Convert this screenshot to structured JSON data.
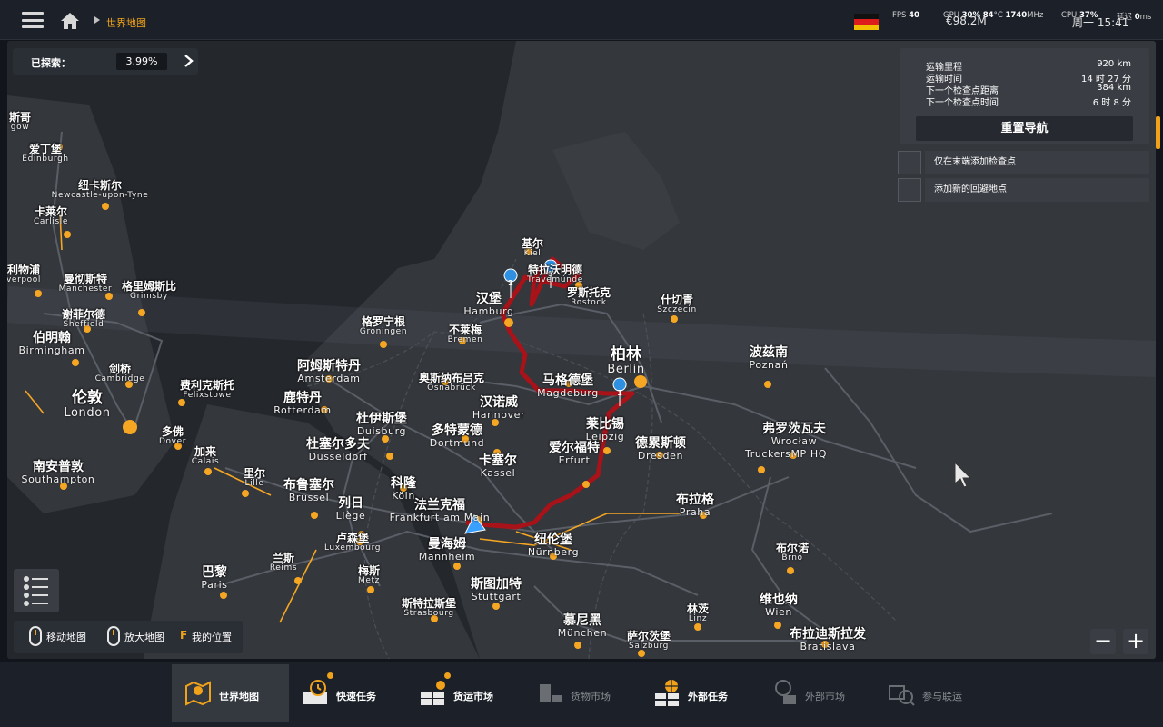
{
  "topbar": {
    "breadcrumb": "世界地图",
    "fps_label": "FPS",
    "fps_value": "40",
    "gpu_label": "GPU",
    "gpu_load": "30",
    "gpu_temp": "84",
    "gpu_temp_unit": "°C",
    "gpu_clock": "1740",
    "gpu_clock_unit": "MHz",
    "cpu_label": "CPU",
    "cpu_load": "37",
    "latency_label": "延迟",
    "latency_value": "0",
    "latency_unit": "ms",
    "money": "€98.2M",
    "clock": "周一 15:41"
  },
  "explore": {
    "label": "已探索：",
    "value": "3.99%"
  },
  "route_info": {
    "rows": [
      {
        "label": "运输里程",
        "value": "920 km"
      },
      {
        "label": "运输时间",
        "value": "14 时 27 分"
      },
      {
        "label": "下一个检查点距离",
        "value": "384 km"
      },
      {
        "label": "下一个检查点时间",
        "value": "6 时 8 分"
      }
    ],
    "reroute_label": "重置导航",
    "option1": "仅在末端添加检查点",
    "option2": "添加新的回避地点"
  },
  "controls": {
    "move_map": "移动地图",
    "zoom_map": "放大地图",
    "my_pos_key": "F",
    "my_pos": "我的位置"
  },
  "zoom": {
    "minus": "−",
    "plus": "+"
  },
  "waypoints": [
    "1",
    "2",
    "3"
  ],
  "cities": [
    {
      "zh": "斯哥",
      "en": "gow"
    },
    {
      "zh": "爱丁堡",
      "en": "Edinburgh"
    },
    {
      "zh": "纽卡斯尔",
      "en": "Newcastle-upon-Tyne"
    },
    {
      "zh": "卡莱尔",
      "en": "Carlisle"
    },
    {
      "zh": "利物浦",
      "en": "verpool"
    },
    {
      "zh": "曼彻斯特",
      "en": "Manchester"
    },
    {
      "zh": "格里姆斯比",
      "en": "Grimsby"
    },
    {
      "zh": "谢菲尔德",
      "en": "Sheffield"
    },
    {
      "zh": "伯明翰",
      "en": "Birmingham"
    },
    {
      "zh": "剑桥",
      "en": "Cambridge"
    },
    {
      "zh": "费利克斯托",
      "en": "Felixstowe"
    },
    {
      "zh": "伦敦",
      "en": "London"
    },
    {
      "zh": "多佛",
      "en": "Dover"
    },
    {
      "zh": "加来",
      "en": "Calais"
    },
    {
      "zh": "南安普敦",
      "en": "Southampton"
    },
    {
      "zh": "里尔",
      "en": "Lille"
    },
    {
      "zh": "布鲁塞尔",
      "en": "Brussel"
    },
    {
      "zh": "列日",
      "en": "Liège"
    },
    {
      "zh": "巴黎",
      "en": "Paris"
    },
    {
      "zh": "兰斯",
      "en": "Reims"
    },
    {
      "zh": "卢森堡",
      "en": "Luxembourg"
    },
    {
      "zh": "梅斯",
      "en": "Metz"
    },
    {
      "zh": "斯特拉斯堡",
      "en": "Strasbourg"
    },
    {
      "zh": "阿姆斯特丹",
      "en": "Amsterdam"
    },
    {
      "zh": "鹿特丹",
      "en": "Rotterdam"
    },
    {
      "zh": "格罗宁根",
      "en": "Groningen"
    },
    {
      "zh": "杜伊斯堡",
      "en": "Duisburg"
    },
    {
      "zh": "杜塞尔多夫",
      "en": "Düsseldorf"
    },
    {
      "zh": "科隆",
      "en": "Köln"
    },
    {
      "zh": "多特蒙德",
      "en": "Dortmund"
    },
    {
      "zh": "奥斯纳布吕克",
      "en": "Osnabrück"
    },
    {
      "zh": "不莱梅",
      "en": "Bremen"
    },
    {
      "zh": "汉堡",
      "en": "Hamburg"
    },
    {
      "zh": "基尔",
      "en": "Kiel"
    },
    {
      "zh": "特拉沃明德",
      "en": "Travemünde"
    },
    {
      "zh": "罗斯托克",
      "en": "Rostock"
    },
    {
      "zh": "什切青",
      "en": "Szczecin"
    },
    {
      "zh": "汉诺威",
      "en": "Hannover"
    },
    {
      "zh": "卡塞尔",
      "en": "Kassel"
    },
    {
      "zh": "法兰克福",
      "en": "Frankfurt am Main"
    },
    {
      "zh": "曼海姆",
      "en": "Mannheim"
    },
    {
      "zh": "斯图加特",
      "en": "Stuttgart"
    },
    {
      "zh": "纽伦堡",
      "en": "Nürnberg"
    },
    {
      "zh": "慕尼黑",
      "en": "München"
    },
    {
      "zh": "萨尔茨堡",
      "en": "Salzburg"
    },
    {
      "zh": "马格德堡",
      "en": "Magdeburg"
    },
    {
      "zh": "柏林",
      "en": "Berlin"
    },
    {
      "zh": "莱比锡",
      "en": "Leipzig"
    },
    {
      "zh": "爱尔福特",
      "en": "Erfurt"
    },
    {
      "zh": "德累斯顿",
      "en": "Dresden"
    },
    {
      "zh": "弗罗茨瓦夫",
      "en": "Wrocław"
    },
    {
      "zh": "",
      "en": "TruckersMP HQ"
    },
    {
      "zh": "波兹南",
      "en": "Poznań"
    },
    {
      "zh": "布拉格",
      "en": "Praha"
    },
    {
      "zh": "布尔诺",
      "en": "Brno"
    },
    {
      "zh": "林茨",
      "en": "Linz"
    },
    {
      "zh": "维也纳",
      "en": "Wien"
    },
    {
      "zh": "布拉迪斯拉发",
      "en": "Bratislava"
    }
  ],
  "tabs": [
    {
      "label": "世界地图"
    },
    {
      "label": "快速任务"
    },
    {
      "label": "货运市场"
    },
    {
      "label": "货物市场"
    },
    {
      "label": "外部任务"
    },
    {
      "label": "外部市场"
    },
    {
      "label": "参与联运"
    }
  ],
  "colors": {
    "accent": "#f0a21a",
    "route": "#b5141a",
    "city_dot": "#f5a623",
    "waypoint": "#2f8fe0"
  }
}
